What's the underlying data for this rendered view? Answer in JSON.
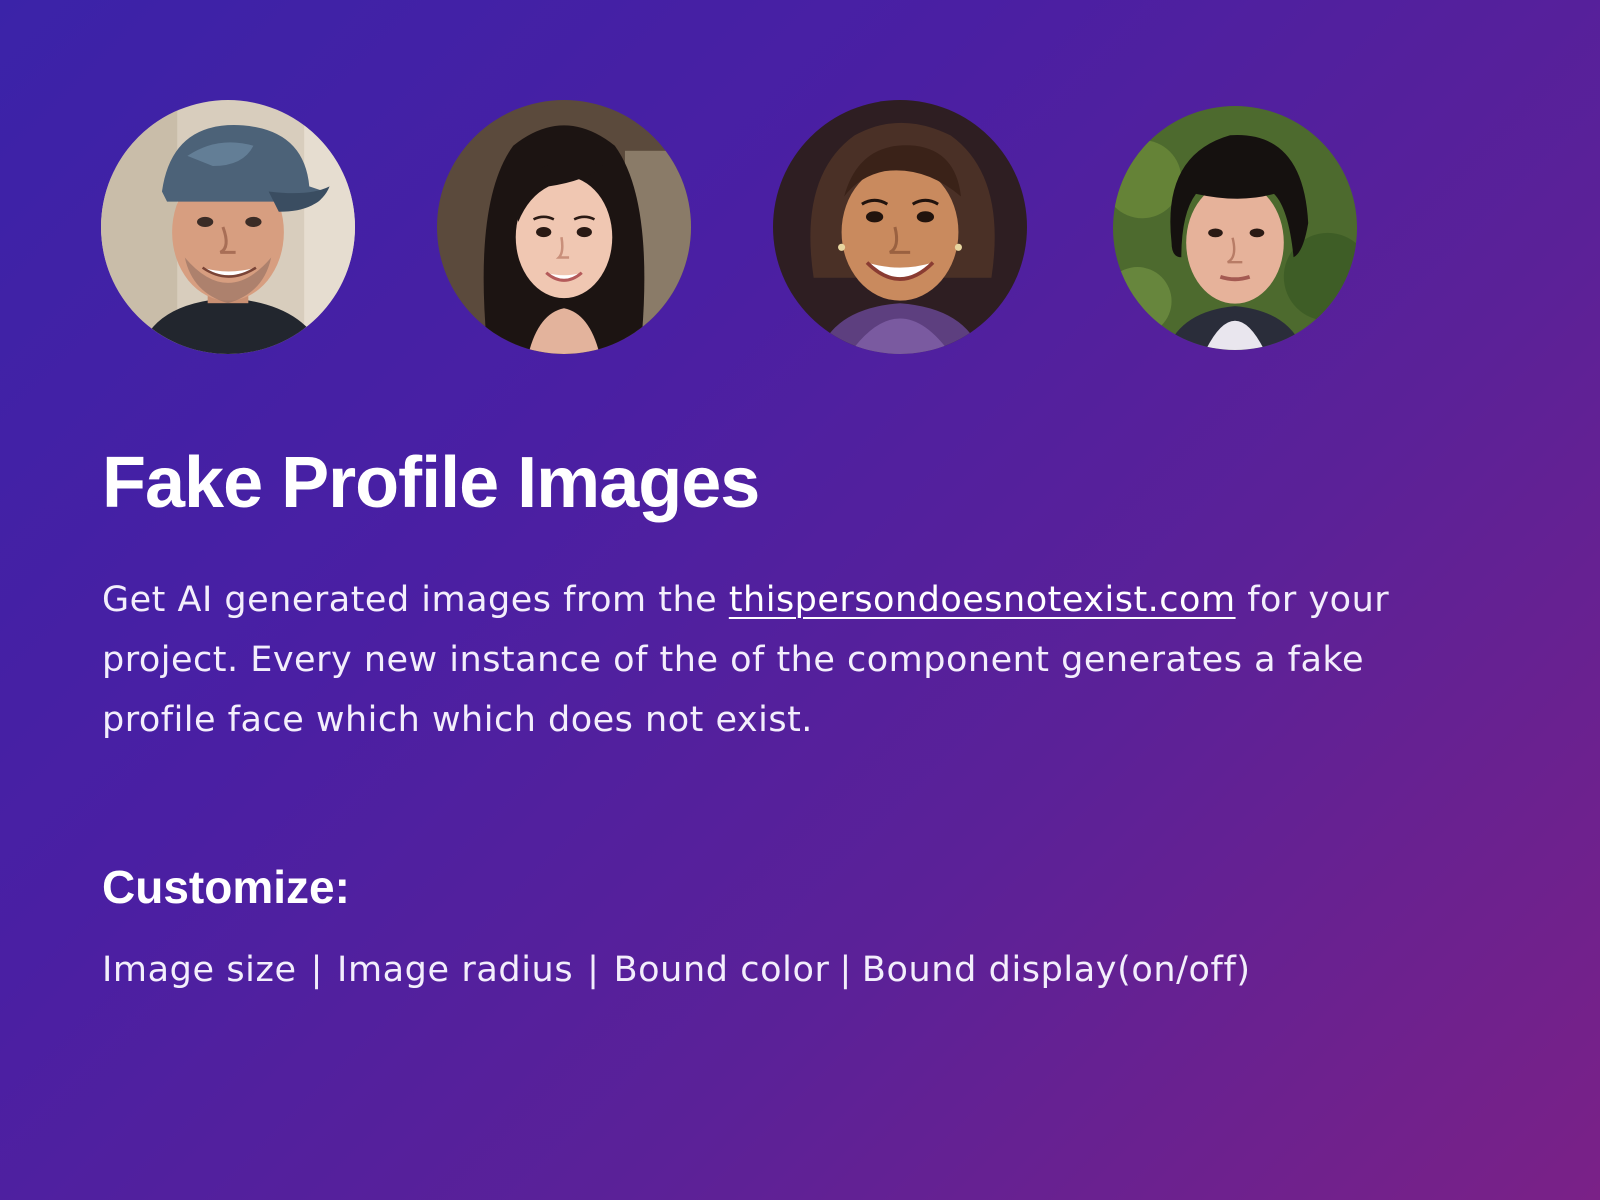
{
  "avatars": [
    {
      "icon": "face-man-cap-icon"
    },
    {
      "icon": "face-woman-long-hair-icon"
    },
    {
      "icon": "face-girl-smiling-icon"
    },
    {
      "icon": "face-person-bangs-icon"
    }
  ],
  "header": {
    "title": "Fake Profile Images"
  },
  "description": {
    "before_link": "Get AI generated images from the ",
    "link_text": "thispersondoesnotexist.com",
    "after_link": " for your project. Every new instance of the of the component generates a fake profile face which which does not exist."
  },
  "customize": {
    "heading": "Customize:",
    "options": [
      "Image size",
      "Image radius",
      "Bound color",
      "Bound display(on/off)"
    ],
    "separator": "|"
  },
  "colors": {
    "gradient_start": "#3b23a8",
    "gradient_end": "#7a2187",
    "text": "#ffffff"
  }
}
